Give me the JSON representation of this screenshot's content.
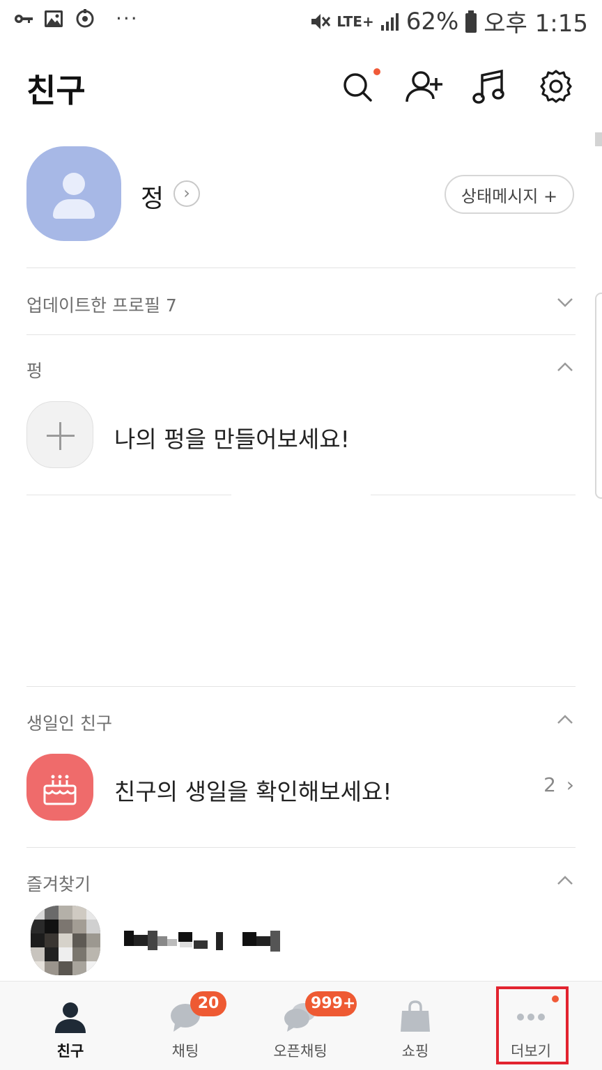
{
  "status_bar": {
    "network": "LTE+",
    "battery": "62%",
    "time": "오후 1:15",
    "more": "···",
    "left_icons": [
      "key-icon",
      "gallery-icon",
      "sync-icon"
    ]
  },
  "header": {
    "title": "친구",
    "icons": [
      "search-icon",
      "add-friend-icon",
      "music-icon",
      "settings-icon"
    ]
  },
  "profile": {
    "name": "정",
    "status_button": "상태메시지 +"
  },
  "sections": {
    "updated_profiles": "업데이트한 프로필 7",
    "pung_label": "펑",
    "pung_prompt": "나의 펑을 만들어보세요!",
    "birthday_label": "생일인 친구",
    "birthday_prompt": "친구의 생일을 확인해보세요!",
    "birthday_count": "2",
    "favorites_label": "즐겨찾기"
  },
  "bottom_nav": {
    "items": [
      {
        "label": "친구",
        "icon": "person-icon",
        "active": true
      },
      {
        "label": "채팅",
        "icon": "chat-icon",
        "badge": "20"
      },
      {
        "label": "오픈채팅",
        "icon": "open-chat-icon",
        "badge": "999+"
      },
      {
        "label": "쇼핑",
        "icon": "shopping-bag-icon"
      },
      {
        "label": "더보기",
        "icon": "more-icon",
        "dot": true
      }
    ]
  },
  "colors": {
    "accent_red": "#f05a38",
    "avatar_blue": "#a7b8e6",
    "birthday_pink": "#ef6b6b",
    "highlight": "#e2232f"
  }
}
